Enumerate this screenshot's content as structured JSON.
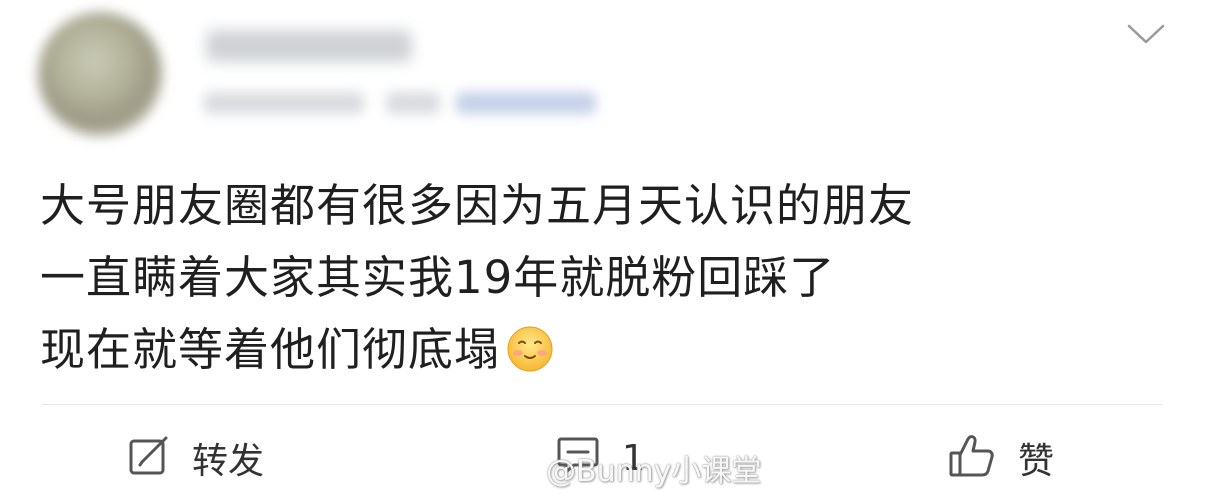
{
  "post": {
    "lines": [
      "大号朋友圈都有很多因为五月天认识的朋友",
      "一直瞒着大家其实我19年就脱粉回踩了",
      "现在就等着他们彻底塌"
    ],
    "emoji": "smile-emoji"
  },
  "actions": {
    "repost_label": "转发",
    "comment_count": "1",
    "like_label": "赞"
  },
  "watermark": {
    "text": "@Bunny小课堂"
  },
  "colors": {
    "text": "#1f1f1f",
    "icon": "#555555",
    "divider": "#e5e5e5"
  }
}
